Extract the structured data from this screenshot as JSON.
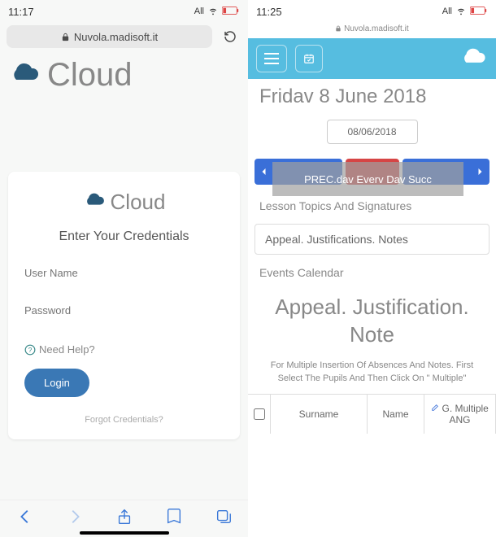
{
  "left": {
    "status": {
      "time": "11:17",
      "carrier": "All"
    },
    "url": "Nuvola.madisoft.it",
    "header_title": "Cloud",
    "login": {
      "title": "Cloud",
      "subtitle": "Enter Your Credentials",
      "username_placeholder": "User Name",
      "password_placeholder": "Password",
      "help": "Need Help?",
      "login_btn": "Login",
      "forgot": "Forgot Credentials?"
    }
  },
  "right": {
    "status": {
      "time": "11:25",
      "carrier": "All"
    },
    "url": "Nuvola.madisoft.it",
    "date_title": "Fridav 8 June 2018",
    "date_input": "08/06/2018",
    "nav": {
      "overlay": "PREC.dav Everv Dav Succ"
    },
    "sections": {
      "lesson": "Lesson Topics And Signatures",
      "appeal_box": "Appeal. Justifications. Notes",
      "events": "Events Calendar"
    },
    "big_heading": "Appeal. Justification. Note",
    "description": "For Multiple Insertion Of Absences And Notes. First Select The Pupils And Then Click On \" Multiple\"",
    "table": {
      "surname": "Surname",
      "name": "Name",
      "multi_line1": "G. Multiple",
      "multi_line2": "ANG"
    }
  }
}
